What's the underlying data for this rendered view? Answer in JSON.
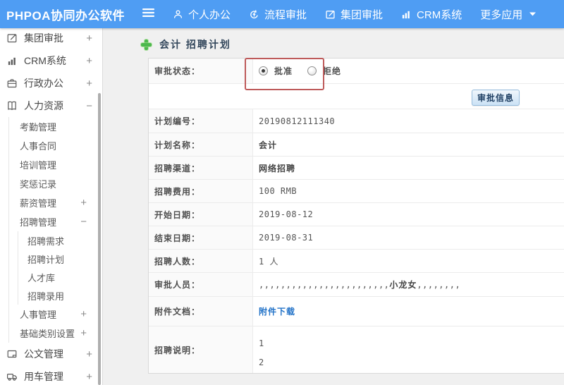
{
  "topbar": {
    "logo": "PHPOA协同办公软件",
    "items": [
      {
        "label": "个人办公"
      },
      {
        "label": "流程审批"
      },
      {
        "label": "集团审批"
      },
      {
        "label": "CRM系统"
      },
      {
        "label": "更多应用"
      }
    ]
  },
  "sidebar": {
    "items": [
      {
        "label": "集团审批",
        "toggle": "+"
      },
      {
        "label": "CRM系统",
        "toggle": "+"
      },
      {
        "label": "行政办公",
        "toggle": "+"
      },
      {
        "label": "人力资源",
        "toggle": "−"
      },
      {
        "label": "考勤管理"
      },
      {
        "label": "人事合同"
      },
      {
        "label": "培训管理"
      },
      {
        "label": "奖惩记录"
      },
      {
        "label": "薪资管理",
        "toggle": "+"
      },
      {
        "label": "招聘管理",
        "toggle": "−"
      },
      {
        "label": "招聘需求"
      },
      {
        "label": "招聘计划"
      },
      {
        "label": "人才库"
      },
      {
        "label": "招聘录用"
      },
      {
        "label": "人事管理",
        "toggle": "+"
      },
      {
        "label": "基础类别设置",
        "toggle": "+"
      },
      {
        "label": "公文管理",
        "toggle": "+"
      },
      {
        "label": "用车管理",
        "toggle": "+"
      }
    ]
  },
  "main": {
    "title": "会计 招聘计划",
    "approval": {
      "label": "审批状态：",
      "options": [
        {
          "label": "批准",
          "selected": true
        },
        {
          "label": "拒绝",
          "selected": false
        }
      ],
      "button": "审批信息"
    },
    "rows": [
      {
        "label": "计划编号：",
        "value": "20190812111340"
      },
      {
        "label": "计划名称：",
        "value": "会计"
      },
      {
        "label": "招聘渠道：",
        "value": "网络招聘"
      },
      {
        "label": "招聘费用：",
        "value": "100 RMB"
      },
      {
        "label": "开始日期：",
        "value": "2019-08-12"
      },
      {
        "label": "结束日期：",
        "value": "2019-08-31"
      },
      {
        "label": "招聘人数：",
        "value": "1 人"
      },
      {
        "label": "审批人员：",
        "prefix": ",,,,,,,,,,,,,,,,,,,,,,,,",
        "name": "小龙女",
        "suffix": ",,,,,,,,"
      },
      {
        "label": "附件文档：",
        "link": "附件下载"
      },
      {
        "label": "招聘说明：",
        "lines": [
          "1",
          "2"
        ]
      }
    ]
  },
  "colors": {
    "topbar_blue": "#4f9df3",
    "link_blue": "#2373c8",
    "annotation_red": "#be5a5a",
    "plus_green": "#4db84d"
  }
}
